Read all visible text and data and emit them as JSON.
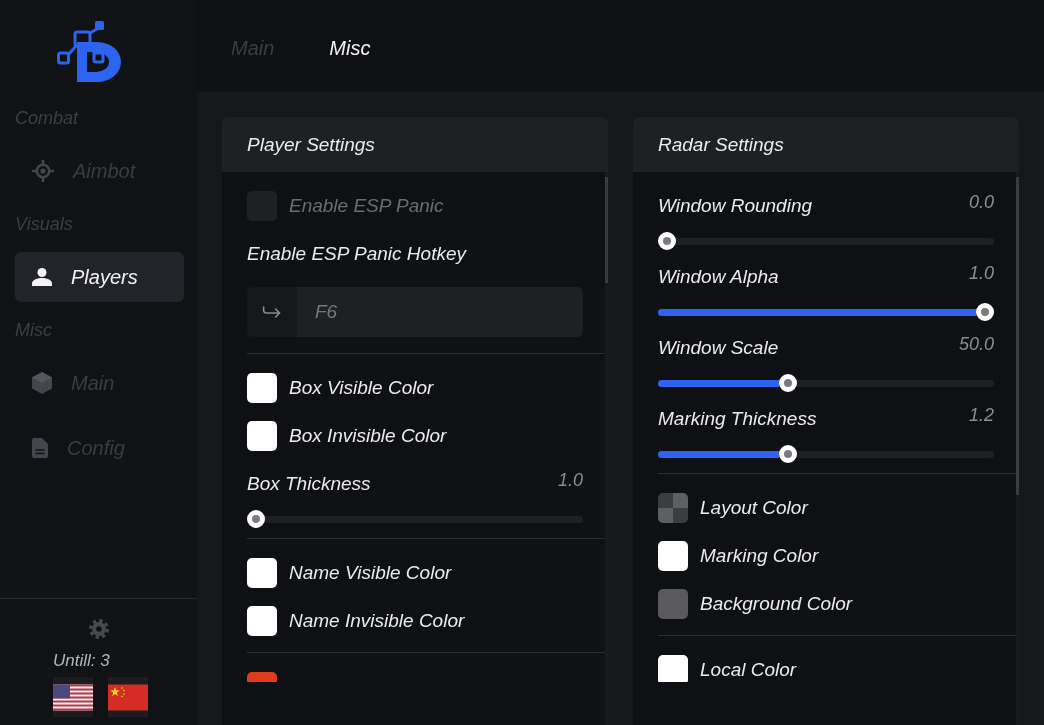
{
  "sidebar": {
    "groups": [
      {
        "title": "Combat",
        "items": [
          {
            "label": "Aimbot",
            "selected": false
          }
        ]
      },
      {
        "title": "Visuals",
        "items": [
          {
            "label": "Players",
            "selected": true
          }
        ]
      },
      {
        "title": "Misc",
        "items": [
          {
            "label": "Main",
            "selected": false
          },
          {
            "label": "Config",
            "selected": false
          }
        ]
      }
    ],
    "footer": {
      "text": "Untill: 3"
    }
  },
  "tabs": [
    {
      "label": "Main",
      "selected": false
    },
    {
      "label": "Misc",
      "selected": true
    }
  ],
  "panels": [
    {
      "title": "Player Settings",
      "sections": [
        {
          "controls": [
            {
              "kind": "checkbox",
              "label": "Enable ESP Panic",
              "checked": false
            },
            {
              "kind": "hotkey",
              "label": "Enable ESP Panic Hotkey",
              "value": "F6"
            }
          ]
        },
        {
          "controls": [
            {
              "kind": "color",
              "label": "Box Visible Color",
              "color": "#ffffff",
              "translucent": false
            },
            {
              "kind": "color",
              "label": "Box Invisible Color",
              "color": "#ffffff",
              "translucent": false
            },
            {
              "kind": "slider",
              "label": "Box Thickness",
              "reading": "1.0",
              "level": 0
            }
          ]
        },
        {
          "controls": [
            {
              "kind": "color",
              "label": "Name Visible Color",
              "color": "#ffffff",
              "translucent": false
            },
            {
              "kind": "color",
              "label": "Name Invisible Color",
              "color": "#ffffff",
              "translucent": false
            }
          ]
        },
        {
          "controls": [
            {
              "kind": "color",
              "color": "#e13b1f",
              "translucent": false
            }
          ]
        }
      ]
    },
    {
      "title": "Radar Settings",
      "sections": [
        {
          "controls": [
            {
              "kind": "slider",
              "label": "Window Rounding",
              "reading": "0.0",
              "level": 0
            },
            {
              "kind": "slider",
              "label": "Window Alpha",
              "reading": "1.0",
              "level": 1
            },
            {
              "kind": "slider",
              "label": "Window Scale",
              "reading": "50.0",
              "level": 0.38
            },
            {
              "kind": "slider",
              "label": "Marking Thickness",
              "reading": "1.2",
              "level": 0.38
            }
          ]
        },
        {
          "controls": [
            {
              "kind": "color",
              "label": "Layout Color",
              "color": "#5e5f63",
              "translucent": true
            },
            {
              "kind": "color",
              "label": "Marking Color",
              "color": "#ffffff",
              "translucent": false
            },
            {
              "kind": "color",
              "label": "Background Color",
              "color": "#5a5a5e",
              "translucent": false
            }
          ]
        },
        {
          "controls": [
            {
              "kind": "color",
              "label": "Local Color",
              "color": "#ffffff",
              "translucent": false
            }
          ]
        }
      ]
    }
  ]
}
